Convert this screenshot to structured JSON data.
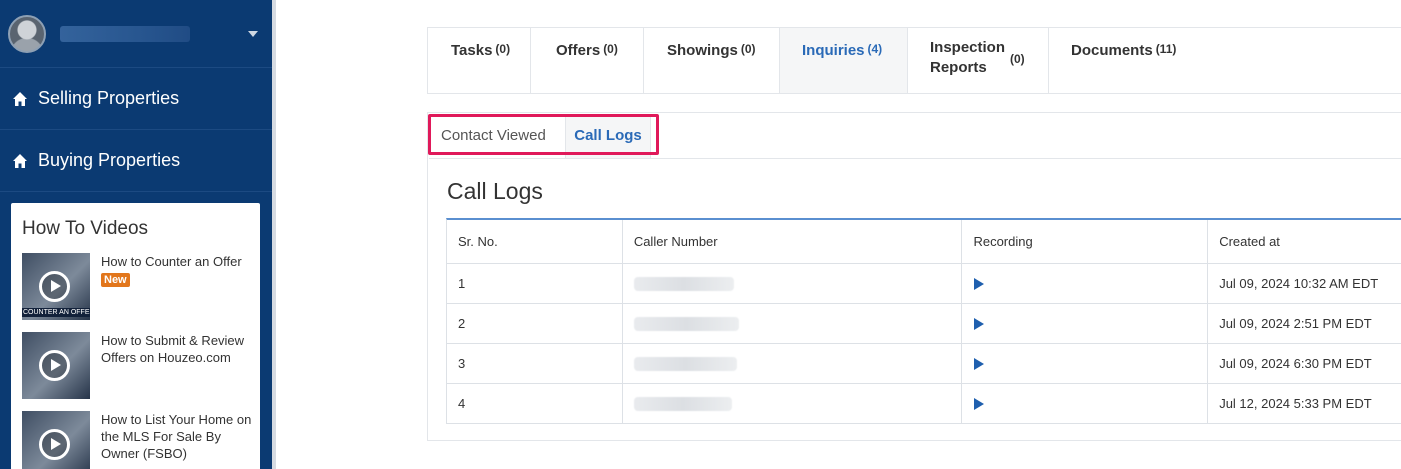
{
  "sidebar": {
    "nav": [
      {
        "label": "Selling Properties",
        "icon": "home-icon"
      },
      {
        "label": "Buying Properties",
        "icon": "home-icon"
      }
    ],
    "videos": {
      "title": "How To Videos",
      "items": [
        {
          "title": "How to Counter an Offer",
          "badge": "New",
          "thumb_band": "COUNTER AN OFFER"
        },
        {
          "title": "How to Submit & Review Offers on Houzeo.com"
        },
        {
          "title": "How to List Your Home on the MLS For Sale By Owner (FSBO)"
        }
      ]
    }
  },
  "tabs": [
    {
      "label": "Tasks",
      "count": "(0)"
    },
    {
      "label": "Offers",
      "count": "(0)"
    },
    {
      "label": "Showings",
      "count": "(0)"
    },
    {
      "label": "Inquiries",
      "count": "(4)",
      "active": true
    },
    {
      "label": "Inspection Reports",
      "label_line1": "Inspection",
      "label_line2": "Reports",
      "count": "(0)"
    },
    {
      "label": "Documents",
      "count": "(11)"
    }
  ],
  "subtabs": [
    {
      "label": "Contact Viewed"
    },
    {
      "label": "Call Logs",
      "active": true
    }
  ],
  "call_logs": {
    "title": "Call Logs",
    "columns": [
      "Sr. No.",
      "Caller Number",
      "Recording",
      "Created at"
    ],
    "rows": [
      {
        "sr": "1",
        "created_at": "Jul 09, 2024 10:32 AM EDT"
      },
      {
        "sr": "2",
        "created_at": "Jul 09, 2024 2:51 PM EDT"
      },
      {
        "sr": "3",
        "created_at": "Jul 09, 2024 6:30 PM EDT"
      },
      {
        "sr": "4",
        "created_at": "Jul 12, 2024 5:33 PM EDT"
      }
    ]
  },
  "colors": {
    "sidebar_bg": "#0b3a72",
    "accent": "#2a6ab7",
    "highlight": "#e0195a",
    "badge": "#e2761b"
  }
}
